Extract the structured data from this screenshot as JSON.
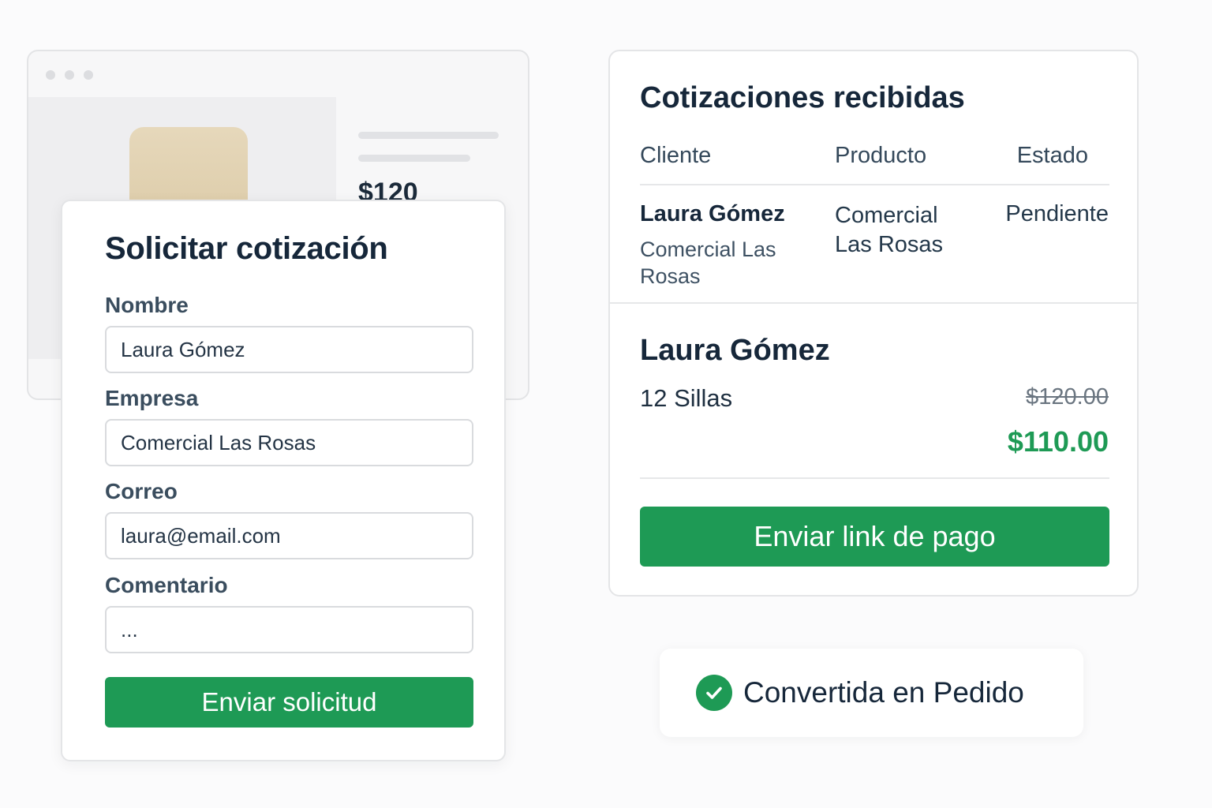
{
  "browser": {
    "price": "$120"
  },
  "form": {
    "title": "Solicitar cotización",
    "fields": [
      {
        "label": "Nombre",
        "value": "Laura Gómez"
      },
      {
        "label": "Empresa",
        "value": "Comercial Las Rosas"
      },
      {
        "label": "Correo",
        "value": "laura@email.com"
      },
      {
        "label": "Comentario",
        "value": "..."
      }
    ],
    "submit_label": "Enviar solicitud"
  },
  "quotes": {
    "title": "Cotizaciones recibidas",
    "columns": [
      "Cliente",
      "Producto",
      "Estado"
    ],
    "row": {
      "client_name": "Laura Gómez",
      "client_company": "Comercial Las Rosas",
      "product": "Comercial Las Rosas",
      "status": "Pendiente"
    },
    "detail": {
      "name": "Laura Gómez",
      "quantity": "12 Sillas",
      "old_price": "$120.00",
      "new_price": "$110.00"
    },
    "pay_button_label": "Enviar link de pago"
  },
  "toast": {
    "text": "Convertida en Pedido",
    "icon": "check-circle-icon"
  },
  "colors": {
    "accent": "#1e9a55",
    "text": "#16273a",
    "border": "#e4e5e7"
  }
}
